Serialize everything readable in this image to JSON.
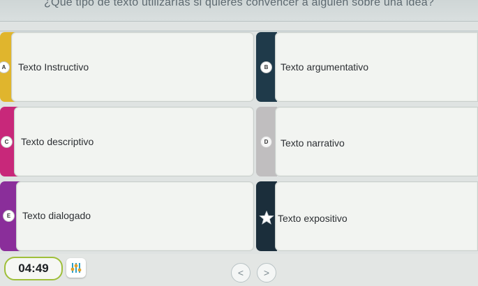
{
  "question": {
    "text": "¿Qué tipo de texto utilizarías si quieres convencer a alguien sobre una idea?"
  },
  "options": [
    {
      "letter": "A",
      "label": "Texto Instructivo",
      "color": "#e0b52d"
    },
    {
      "letter": "B",
      "label": "Texto argumentativo",
      "color": "#1f3a4a"
    },
    {
      "letter": "C",
      "label": "Texto descriptivo",
      "color": "#c8287a"
    },
    {
      "letter": "D",
      "label": "Texto narrativo",
      "color": "#c0bebf"
    },
    {
      "letter": "E",
      "label": "Texto dialogado",
      "color": "#8a2e9a"
    },
    {
      "letter": "",
      "label": "Texto expositivo",
      "color": "#1b2e3b"
    }
  ],
  "footer": {
    "timer": "04:49",
    "settings_icon": "sliders-icon",
    "prev_icon": "chevron-left-icon",
    "next_icon": "chevron-right-icon",
    "prev_glyph": "<",
    "next_glyph": ">",
    "accent_color": "#9fbf3a"
  }
}
